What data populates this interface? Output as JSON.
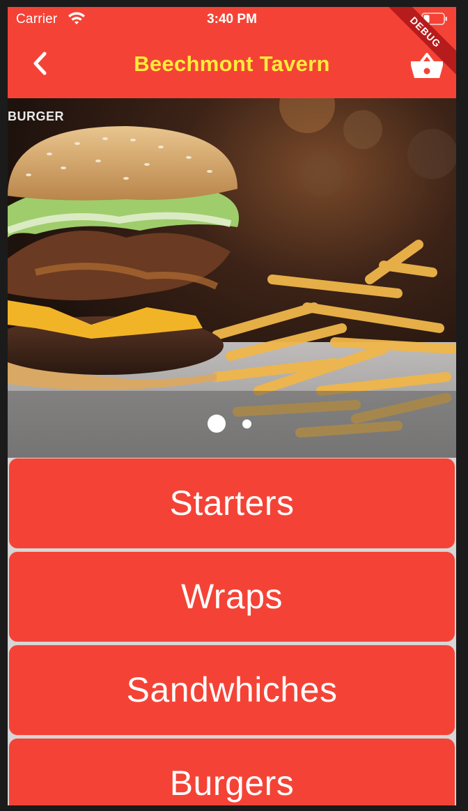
{
  "status_bar": {
    "carrier": "Carrier",
    "time": "3:40 PM"
  },
  "app_bar": {
    "title": "Beechmont Tavern",
    "back_icon": "chevron-left-icon",
    "cart_icon": "basket-icon",
    "debug_label": "DEBUG"
  },
  "carousel": {
    "caption": "BURGER",
    "page_count": 2,
    "active_index": 0
  },
  "menu": {
    "categories": [
      "Starters",
      "Wraps",
      "Sandwhiches",
      "Burgers"
    ]
  },
  "colors": {
    "primary": "#f44336",
    "title": "#ffeb3b",
    "button_text": "#ffffff"
  }
}
